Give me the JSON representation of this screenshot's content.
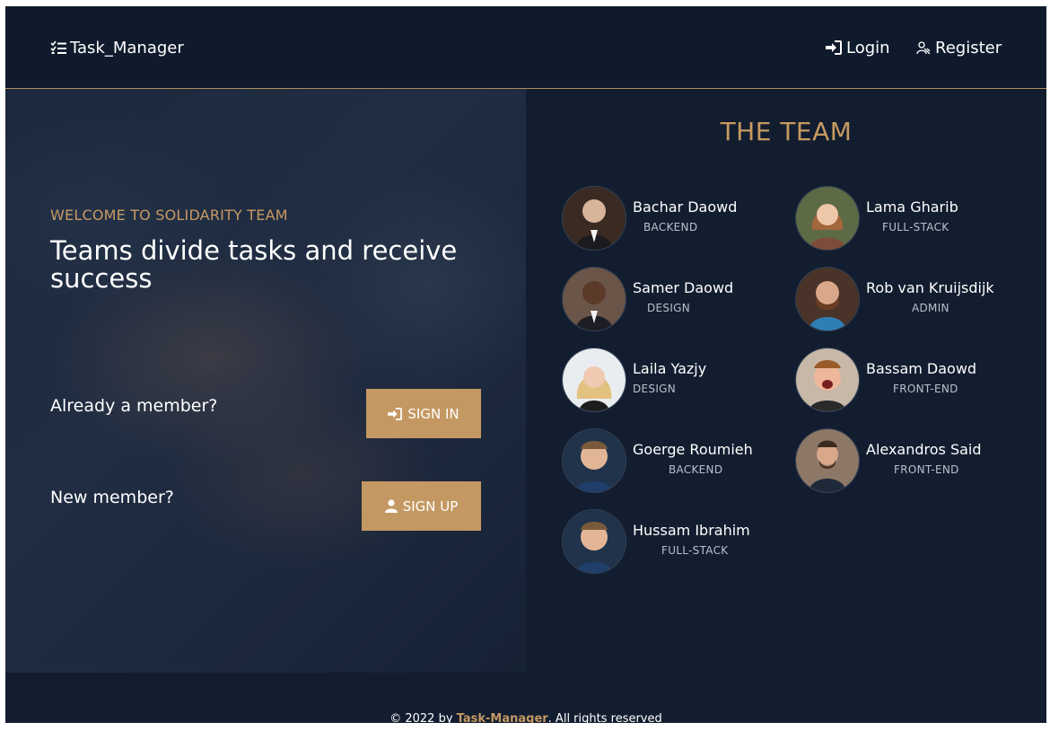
{
  "navbar": {
    "brand": "Task_Manager",
    "login": "Login",
    "register": "Register"
  },
  "hero": {
    "eyebrow": "WELCOME TO SOLIDARITY TEAM",
    "title": "Teams divide tasks and receive success",
    "member_prompt": "Already a member?",
    "sign_in": "SIGN IN",
    "new_prompt": "New member?",
    "sign_up": "SIGN UP"
  },
  "team": {
    "title": "THE TEAM",
    "members": [
      {
        "name": "Bachar Daowd",
        "role": "BACKEND"
      },
      {
        "name": "Lama Gharib",
        "role": "FULL-STACK"
      },
      {
        "name": "Samer Daowd",
        "role": "DESIGN"
      },
      {
        "name": "Rob van Kruijsdijk",
        "role": "ADMIN"
      },
      {
        "name": "Laila Yazjy",
        "role": "DESIGN"
      },
      {
        "name": "Bassam Daowd",
        "role": "FRONT-END"
      },
      {
        "name": "Goerge Roumieh",
        "role": "BACKEND"
      },
      {
        "name": "Alexandros Said",
        "role": "FRONT-END"
      },
      {
        "name": "Hussam Ibrahim",
        "role": "FULL-STACK"
      }
    ]
  },
  "footer": {
    "prefix": "© 2022 by ",
    "brand": "Task-Manager",
    "suffix": ". All rights reserved"
  },
  "colors": {
    "accent": "#c49862",
    "background": "#121d2f",
    "navbar": "#0f1b2c"
  },
  "icons": {
    "brand": "checklist-icon",
    "login": "sign-in-icon",
    "register": "user-plus-icon",
    "sign_in_button": "sign-in-icon",
    "sign_up_button": "user-icon"
  }
}
